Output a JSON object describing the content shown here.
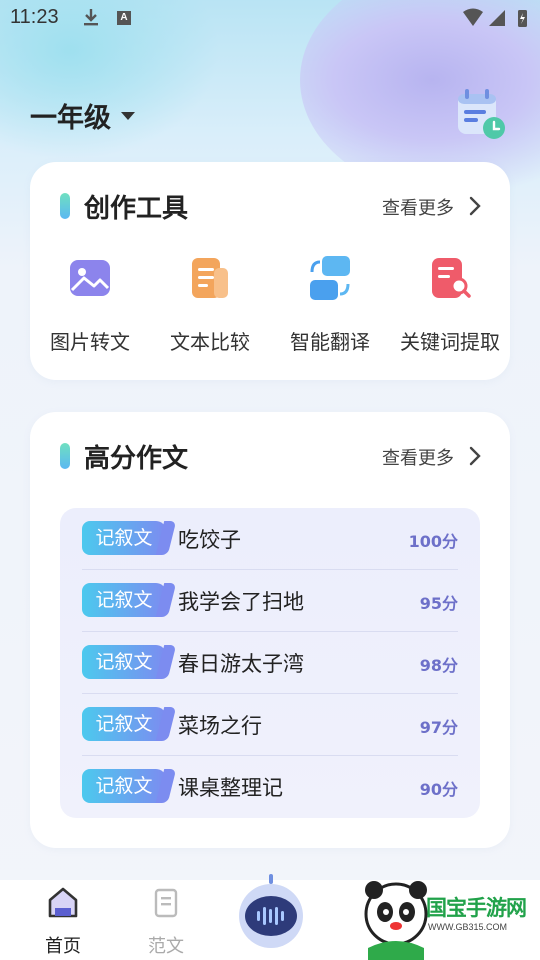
{
  "status_bar": {
    "time": "11:23",
    "a_badge": "A"
  },
  "header": {
    "grade": "一年级"
  },
  "tools_card": {
    "title": "创作工具",
    "more": "查看更多",
    "tools": [
      {
        "label": "图片转文",
        "icon": "image-icon"
      },
      {
        "label": "文本比较",
        "icon": "document-icon"
      },
      {
        "label": "智能翻译",
        "icon": "translate-icon"
      },
      {
        "label": "关键词提取",
        "icon": "keyword-search-icon"
      }
    ]
  },
  "essays_card": {
    "title": "高分作文",
    "more": "查看更多",
    "essays": [
      {
        "tag": "记叙文",
        "title": "吃饺子",
        "score": "100分"
      },
      {
        "tag": "记叙文",
        "title": "我学会了扫地",
        "score": "95分"
      },
      {
        "tag": "记叙文",
        "title": "春日游太子湾",
        "score": "98分"
      },
      {
        "tag": "记叙文",
        "title": "菜场之行",
        "score": "97分"
      },
      {
        "tag": "记叙文",
        "title": "课桌整理记",
        "score": "90分"
      }
    ]
  },
  "bottom_nav": {
    "items": [
      {
        "label": "首页",
        "active": true
      },
      {
        "label": "范文",
        "active": false
      }
    ]
  },
  "watermark": {
    "text": "国宝手游网",
    "url": "WWW.GB315.COM"
  },
  "colors": {
    "accent_purple": "#6d70c9",
    "tag_gradient_start": "#4cc9ee",
    "tag_gradient_end": "#7c8cf0"
  }
}
